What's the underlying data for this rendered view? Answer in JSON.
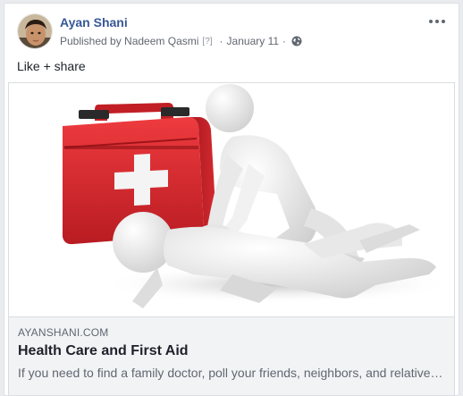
{
  "post": {
    "author": "Ayan Shani",
    "published_by": "Published by Nadeem Qasmi",
    "help_marker": "[?]",
    "separator": "·",
    "date": "January 11",
    "privacy_icon": "globe-icon",
    "more_icon": "more-options-icon",
    "text": "Like + share"
  },
  "link_preview": {
    "domain": "AYANSHANI.COM",
    "title": "Health Care and First Aid",
    "description": "If you need to find a family doctor, poll your friends, neighbors, and relatives for recommendations.",
    "image_subject": "first-aid-cpr-illustration"
  },
  "colors": {
    "author_link": "#385898",
    "meta_text": "#616770",
    "preview_bg": "#f2f3f5",
    "first_aid_red": "#d6262b"
  }
}
